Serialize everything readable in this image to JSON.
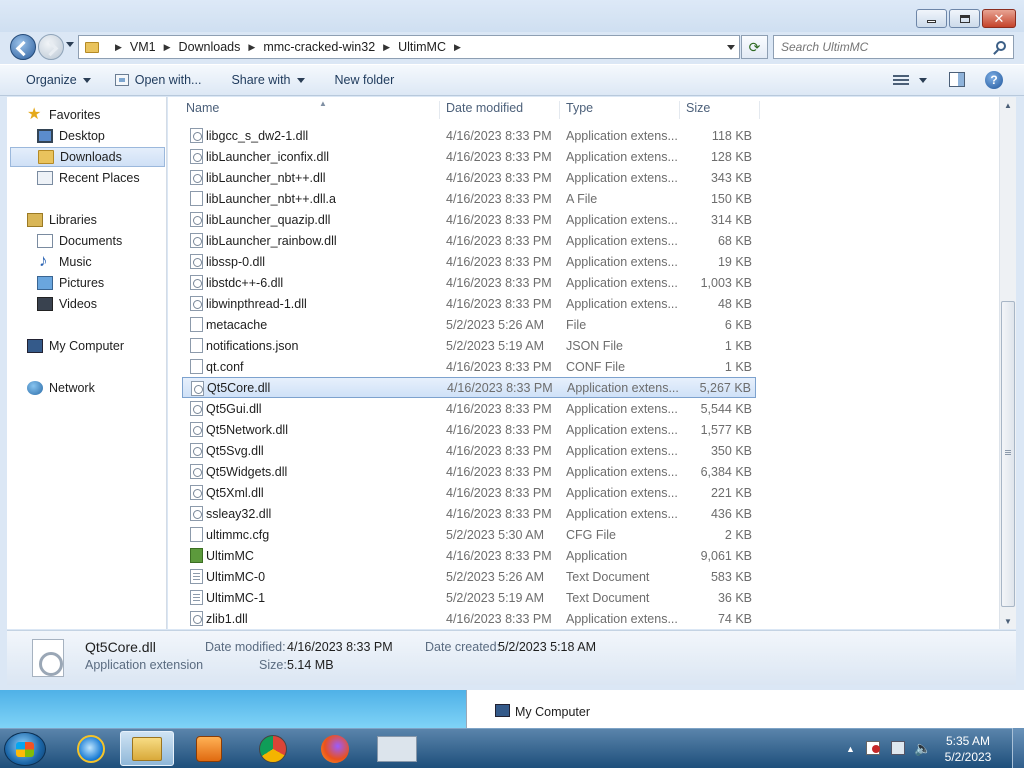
{
  "address": {
    "crumbs": [
      "VM1",
      "Downloads",
      "mmc-cracked-win32",
      "UltimMC"
    ],
    "search_placeholder": "Search UltimMC"
  },
  "toolbar": {
    "organize": "Organize",
    "open_with": "Open with...",
    "share_with": "Share with",
    "new_folder": "New folder"
  },
  "nav": {
    "favorites": "Favorites",
    "desktop": "Desktop",
    "downloads": "Downloads",
    "recent_places": "Recent Places",
    "libraries": "Libraries",
    "documents": "Documents",
    "music": "Music",
    "pictures": "Pictures",
    "videos": "Videos",
    "my_computer": "My Computer",
    "network": "Network"
  },
  "columns": {
    "name": "Name",
    "date": "Date modified",
    "type": "Type",
    "size": "Size"
  },
  "files": [
    {
      "name": "libgcc_s_dw2-1.dll",
      "date": "4/16/2023 8:33 PM",
      "type": "Application extens...",
      "size": "118 KB",
      "icon": "dll"
    },
    {
      "name": "libLauncher_iconfix.dll",
      "date": "4/16/2023 8:33 PM",
      "type": "Application extens...",
      "size": "128 KB",
      "icon": "dll"
    },
    {
      "name": "libLauncher_nbt++.dll",
      "date": "4/16/2023 8:33 PM",
      "type": "Application extens...",
      "size": "343 KB",
      "icon": "dll"
    },
    {
      "name": "libLauncher_nbt++.dll.a",
      "date": "4/16/2023 8:33 PM",
      "type": "A File",
      "size": "150 KB",
      "icon": "blank"
    },
    {
      "name": "libLauncher_quazip.dll",
      "date": "4/16/2023 8:33 PM",
      "type": "Application extens...",
      "size": "314 KB",
      "icon": "dll"
    },
    {
      "name": "libLauncher_rainbow.dll",
      "date": "4/16/2023 8:33 PM",
      "type": "Application extens...",
      "size": "68 KB",
      "icon": "dll"
    },
    {
      "name": "libssp-0.dll",
      "date": "4/16/2023 8:33 PM",
      "type": "Application extens...",
      "size": "19 KB",
      "icon": "dll"
    },
    {
      "name": "libstdc++-6.dll",
      "date": "4/16/2023 8:33 PM",
      "type": "Application extens...",
      "size": "1,003 KB",
      "icon": "dll"
    },
    {
      "name": "libwinpthread-1.dll",
      "date": "4/16/2023 8:33 PM",
      "type": "Application extens...",
      "size": "48 KB",
      "icon": "dll"
    },
    {
      "name": "metacache",
      "date": "5/2/2023 5:26 AM",
      "type": "File",
      "size": "6 KB",
      "icon": "blank"
    },
    {
      "name": "notifications.json",
      "date": "5/2/2023 5:19 AM",
      "type": "JSON File",
      "size": "1 KB",
      "icon": "blank"
    },
    {
      "name": "qt.conf",
      "date": "4/16/2023 8:33 PM",
      "type": "CONF File",
      "size": "1 KB",
      "icon": "blank"
    },
    {
      "name": "Qt5Core.dll",
      "date": "4/16/2023 8:33 PM",
      "type": "Application extens...",
      "size": "5,267 KB",
      "icon": "dll",
      "selected": true
    },
    {
      "name": "Qt5Gui.dll",
      "date": "4/16/2023 8:33 PM",
      "type": "Application extens...",
      "size": "5,544 KB",
      "icon": "dll"
    },
    {
      "name": "Qt5Network.dll",
      "date": "4/16/2023 8:33 PM",
      "type": "Application extens...",
      "size": "1,577 KB",
      "icon": "dll"
    },
    {
      "name": "Qt5Svg.dll",
      "date": "4/16/2023 8:33 PM",
      "type": "Application extens...",
      "size": "350 KB",
      "icon": "dll"
    },
    {
      "name": "Qt5Widgets.dll",
      "date": "4/16/2023 8:33 PM",
      "type": "Application extens...",
      "size": "6,384 KB",
      "icon": "dll"
    },
    {
      "name": "Qt5Xml.dll",
      "date": "4/16/2023 8:33 PM",
      "type": "Application extens...",
      "size": "221 KB",
      "icon": "dll"
    },
    {
      "name": "ssleay32.dll",
      "date": "4/16/2023 8:33 PM",
      "type": "Application extens...",
      "size": "436 KB",
      "icon": "dll"
    },
    {
      "name": "ultimmc.cfg",
      "date": "5/2/2023 5:30 AM",
      "type": "CFG File",
      "size": "2 KB",
      "icon": "blank"
    },
    {
      "name": "UltimMC",
      "date": "4/16/2023 8:33 PM",
      "type": "Application",
      "size": "9,061 KB",
      "icon": "app"
    },
    {
      "name": "UltimMC-0",
      "date": "5/2/2023 5:26 AM",
      "type": "Text Document",
      "size": "583 KB",
      "icon": "txt"
    },
    {
      "name": "UltimMC-1",
      "date": "5/2/2023 5:19 AM",
      "type": "Text Document",
      "size": "36 KB",
      "icon": "txt"
    },
    {
      "name": "zlib1.dll",
      "date": "4/16/2023 8:33 PM",
      "type": "Application extens...",
      "size": "74 KB",
      "icon": "dll"
    }
  ],
  "details": {
    "filename": "Qt5Core.dll",
    "filetype": "Application extension",
    "date_modified_label": "Date modified:",
    "date_modified": "4/16/2023 8:33 PM",
    "date_created_label": "Date created:",
    "date_created": "5/2/2023 5:18 AM",
    "size_label": "Size:",
    "size": "5.14 MB"
  },
  "tooltip": {
    "label": "My Computer"
  },
  "tray": {
    "time": "5:35 AM",
    "date": "5/2/2023"
  },
  "colors": {
    "selection": "#cfe1f7",
    "taskbar": "#1e4f7b",
    "window_frame": "#dbe7f5"
  }
}
